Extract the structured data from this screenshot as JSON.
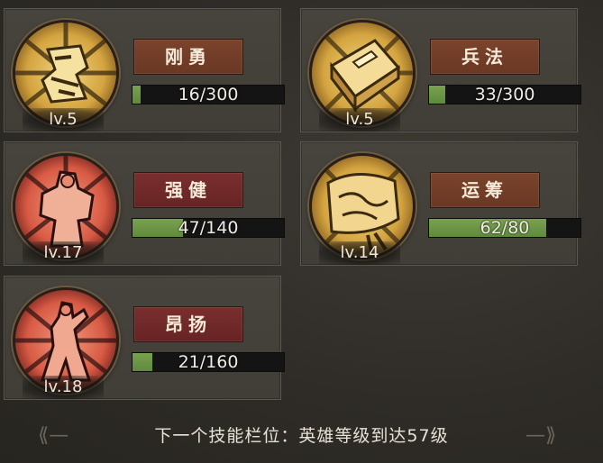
{
  "skills": [
    {
      "name": "刚勇",
      "level": "lv.5",
      "progress": "16/300",
      "fill": 0.053,
      "theme": "gold",
      "label_color": "brown",
      "icon": "tiger-emblem-icon"
    },
    {
      "name": "兵法",
      "level": "lv.5",
      "progress": "33/300",
      "fill": 0.11,
      "theme": "gold",
      "label_color": "brown",
      "icon": "war-book-icon"
    },
    {
      "name": "强健",
      "level": "lv.17",
      "progress": "47/140",
      "fill": 0.336,
      "theme": "red",
      "label_color": "red",
      "icon": "warrior-emblem-icon"
    },
    {
      "name": "运筹",
      "level": "lv.14",
      "progress": "62/80",
      "fill": 0.775,
      "theme": "gold",
      "label_color": "brown",
      "icon": "strategy-map-icon"
    },
    {
      "name": "昂扬",
      "level": "lv.18",
      "progress": "21/160",
      "fill": 0.131,
      "theme": "red",
      "label_color": "red",
      "icon": "rallying-figure-icon"
    }
  ],
  "footer": {
    "text": "下一个技能栏位：英雄等级到达57级"
  },
  "colors": {
    "bar_fill": "#6f9847",
    "label_brown": "#713d28",
    "label_red": "#6f2a2a",
    "gold": "#d8a94a",
    "red": "#d8604a"
  }
}
